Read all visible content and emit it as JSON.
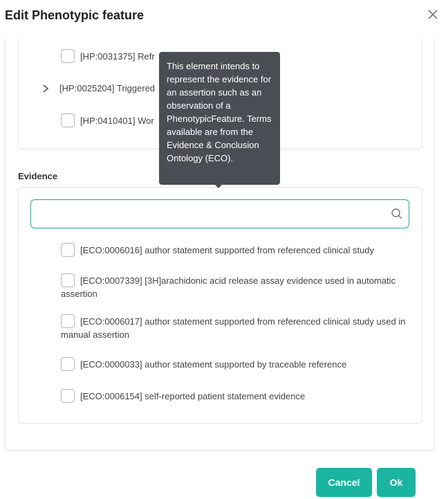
{
  "dialog": {
    "title": "Edit Phenotypic feature"
  },
  "tree": {
    "items": [
      {
        "label": "[HP:0031375] Refr",
        "has_checkbox": true
      },
      {
        "label": "[HP:0025204] Triggered",
        "has_chevron": true
      },
      {
        "label": "[HP:0410401] Wor",
        "has_checkbox": true
      }
    ]
  },
  "evidence": {
    "section_label": "Evidence",
    "search": {
      "value": "",
      "placeholder": ""
    },
    "items": [
      {
        "label": "[ECO:0006016] author statement supported from referenced clinical study"
      },
      {
        "label": "[ECO:0007339] [3H]arachidonic acid release assay evidence used in automatic assertion"
      },
      {
        "label": "[ECO:0006017] author statement supported from referenced clinical study used in manual assertion"
      },
      {
        "label": "[ECO:0000033] author statement supported by traceable reference"
      },
      {
        "label": "[ECO:0006154] self-reported patient statement evidence"
      }
    ]
  },
  "tooltip": {
    "text": "This element intends to represent the evidence for an assertion such as an observation of a PhenotypicFeature. Terms available are from the Evidence & Conclusion Ontology (ECO)."
  },
  "buttons": {
    "cancel_label": "Cancel",
    "ok_label": "Ok"
  },
  "colors": {
    "accent": "#19b5a0",
    "tooltip_bg": "#4a4e54"
  }
}
